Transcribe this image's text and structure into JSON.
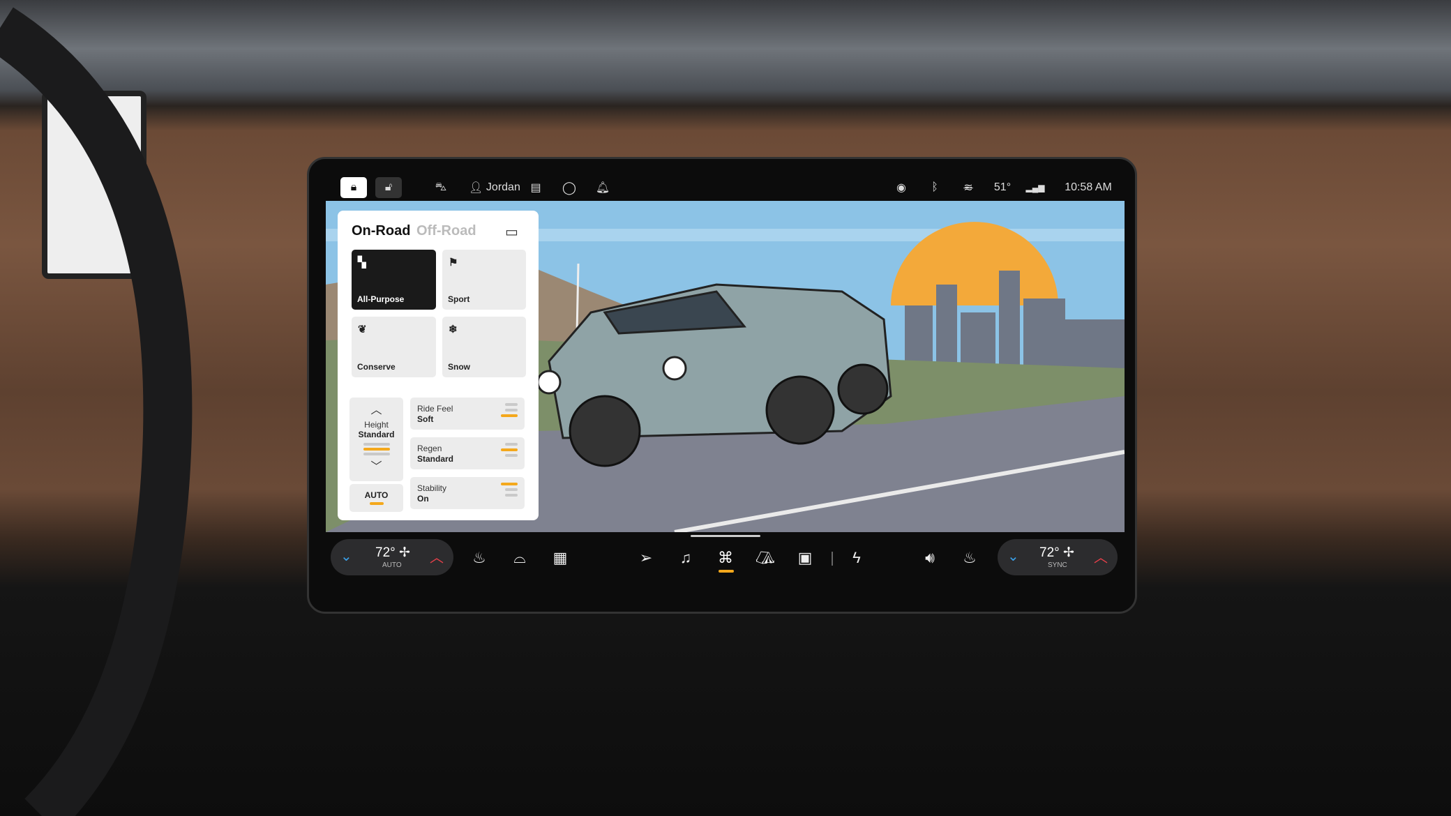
{
  "status_bar": {
    "user": "Jordan",
    "temperature": "51°",
    "time": "10:58 AM",
    "icons": [
      "lock-icon",
      "unlock-icon",
      "car-icon",
      "person-icon",
      "garage-icon",
      "circle-icon",
      "bell-icon",
      "hotspot-icon",
      "bluetooth-icon",
      "wifi-off-icon",
      "signal-icon"
    ]
  },
  "drive_panel": {
    "tabs": [
      {
        "label": "On-Road",
        "active": true
      },
      {
        "label": "Off-Road",
        "active": false
      }
    ],
    "modes": [
      {
        "label": "All-Purpose",
        "icon": "road-icon",
        "selected": true
      },
      {
        "label": "Sport",
        "icon": "flag-icon",
        "selected": false
      },
      {
        "label": "Conserve",
        "icon": "leaf-icon",
        "selected": false
      },
      {
        "label": "Snow",
        "icon": "snowflake-icon",
        "selected": false
      }
    ],
    "height": {
      "label": "Height",
      "value": "Standard",
      "level": 2,
      "levels": 3,
      "auto_label": "AUTO"
    },
    "settings": [
      {
        "label": "Ride Feel",
        "value": "Soft",
        "level": 1,
        "levels": 3
      },
      {
        "label": "Regen",
        "value": "Standard",
        "level": 2,
        "levels": 3
      },
      {
        "label": "Stability",
        "value": "On",
        "level": 3,
        "levels": 3
      }
    ]
  },
  "climate": {
    "left": {
      "temp": "72°",
      "mode": "AUTO"
    },
    "right": {
      "temp": "72°",
      "mode": "SYNC"
    }
  },
  "dock": {
    "icons": [
      "seat-heat-icon",
      "front-defrost-icon",
      "rear-defrost-icon",
      "navigation-icon",
      "music-icon",
      "vehicle-icon",
      "camp-icon",
      "camera-icon",
      "charging-icon",
      "volume-icon",
      "seat-heat-right-icon"
    ],
    "active": "vehicle-icon"
  },
  "colors": {
    "accent": "#f4a81c",
    "temp_down": "#3aa0e8",
    "temp_up": "#e8404a",
    "sky": "#8cc3e6",
    "sun": "#f3a93a"
  }
}
